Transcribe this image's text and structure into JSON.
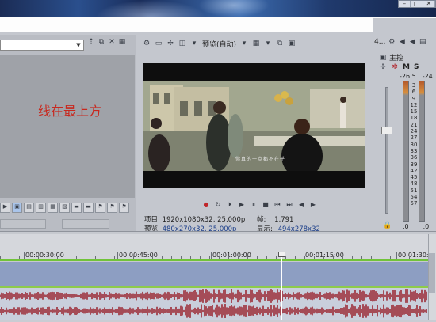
{
  "window_buttons": [
    "–",
    "□",
    "✕"
  ],
  "left_panel": {
    "dropdown_value": "",
    "overlay_text": "线在最上方"
  },
  "preview": {
    "quality_label": "预览(自动)",
    "info": {
      "project_label": "项目:",
      "project_value": "1920x1080x32, 25.000p",
      "preview_label": "预览:",
      "preview_value": "480x270x32, 25.000p",
      "frame_label": "帧:",
      "frame_value": "1,791",
      "display_label": "显示:",
      "display_value": "494x278x32"
    },
    "video_caption": "你真的一点都不在乎"
  },
  "mixer": {
    "header_label": "4...",
    "master_label": "主控",
    "m_label": "M",
    "s_label": "S",
    "db_left_top": "-26.5",
    "db_right_top": "-24.3",
    "scale": [
      "3",
      "6",
      "9",
      "12",
      "15",
      "18",
      "21",
      "24",
      "27",
      "30",
      "33",
      "36",
      "39",
      "42",
      "45",
      "48",
      "51",
      "54",
      "57"
    ],
    "db_left_bottom": ".0",
    "db_right_bottom": ".0"
  },
  "timeline": {
    "timecodes": [
      "00:00:30:00",
      "00:00:45:00",
      "00:01:00:00",
      "00:01:15:00",
      "00:01:30:0"
    ],
    "colors": {
      "video_track": "#8d9ec2",
      "audio_wave": "#9c2b36",
      "marker_line": "#71c33a"
    }
  }
}
